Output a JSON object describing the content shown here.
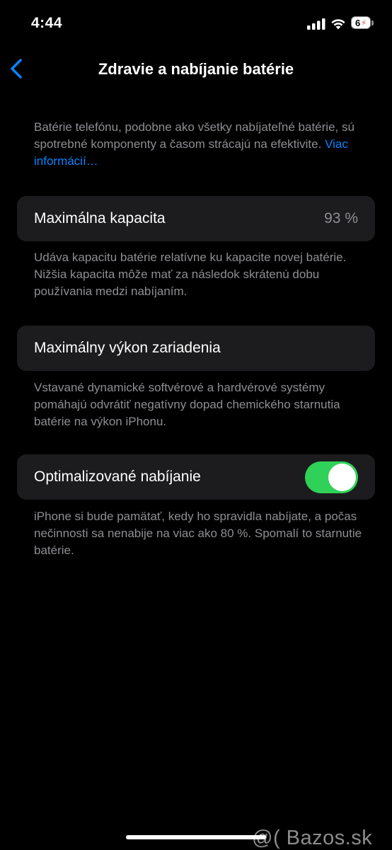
{
  "status_bar": {
    "time": "4:44",
    "battery_level": "6"
  },
  "nav": {
    "back_icon": "chevron-left-icon",
    "title": "Zdravie a nabíjanie batérie"
  },
  "intro": {
    "text": "Batérie telefónu, podobne ako všetky nabíjateľné batérie, sú spotrebné komponenty a časom strácajú na efektivite. ",
    "link": "Viac informácií…"
  },
  "max_capacity": {
    "label": "Maximálna kapacita",
    "value": "93 %",
    "description": "Udáva kapacitu batérie relatívne ku kapacite novej batérie. Nižšia kapacita môže mať za následok skrátenú dobu používania medzi nabíjaním."
  },
  "peak_performance": {
    "label": "Maximálny výkon zariadenia",
    "description": "Vstavané dynamické softvérové a hardvérové systémy pomáhajú odvrátiť negatívny dopad chemického starnutia batérie na výkon iPhonu."
  },
  "optimized_charging": {
    "label": "Optimalizované nabíjanie",
    "enabled": true,
    "description": "iPhone si bude pamätať, kedy ho spravidla nabíjate, a počas nečinnosti sa nenabije na viac ako 80 %. Spomalí to starnutie batérie."
  },
  "watermark": "@( Bazos.sk",
  "colors": {
    "accent": "#0a84ff",
    "toggle_on": "#30d158",
    "card_bg": "#1c1c1e",
    "secondary_text": "#8e8e93"
  }
}
